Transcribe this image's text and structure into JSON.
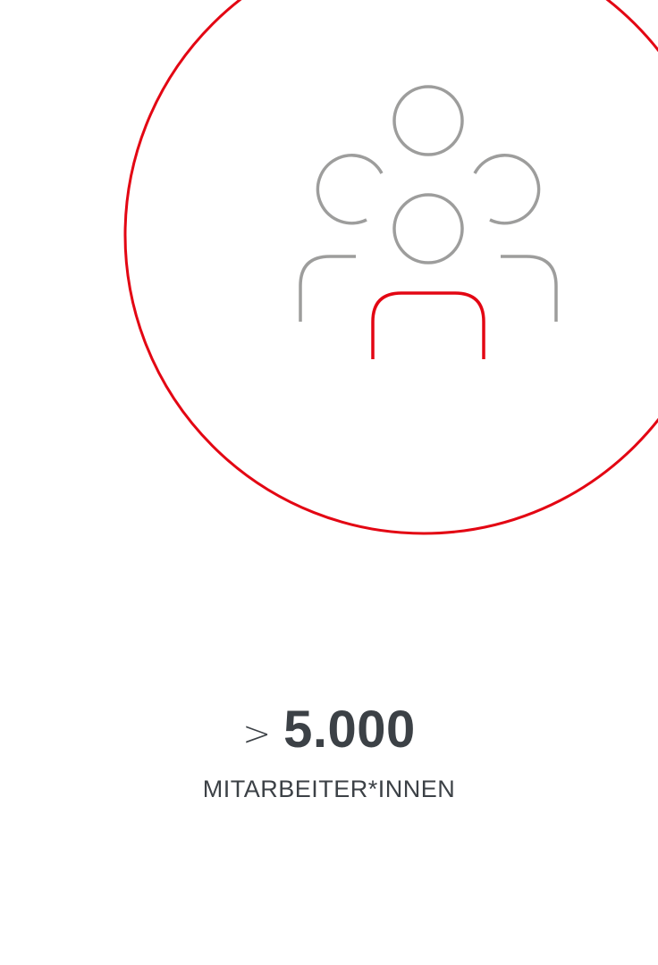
{
  "icon": {
    "name": "team-people-icon",
    "colors": {
      "ring": "#e30613",
      "people": "#9d9d9c",
      "highlight": "#e30613"
    }
  },
  "stat": {
    "prefix": ">",
    "value": "5.000",
    "label": "MITARBEITER*INNEN"
  },
  "colors": {
    "text": "#3c4146",
    "background": "#ffffff"
  }
}
